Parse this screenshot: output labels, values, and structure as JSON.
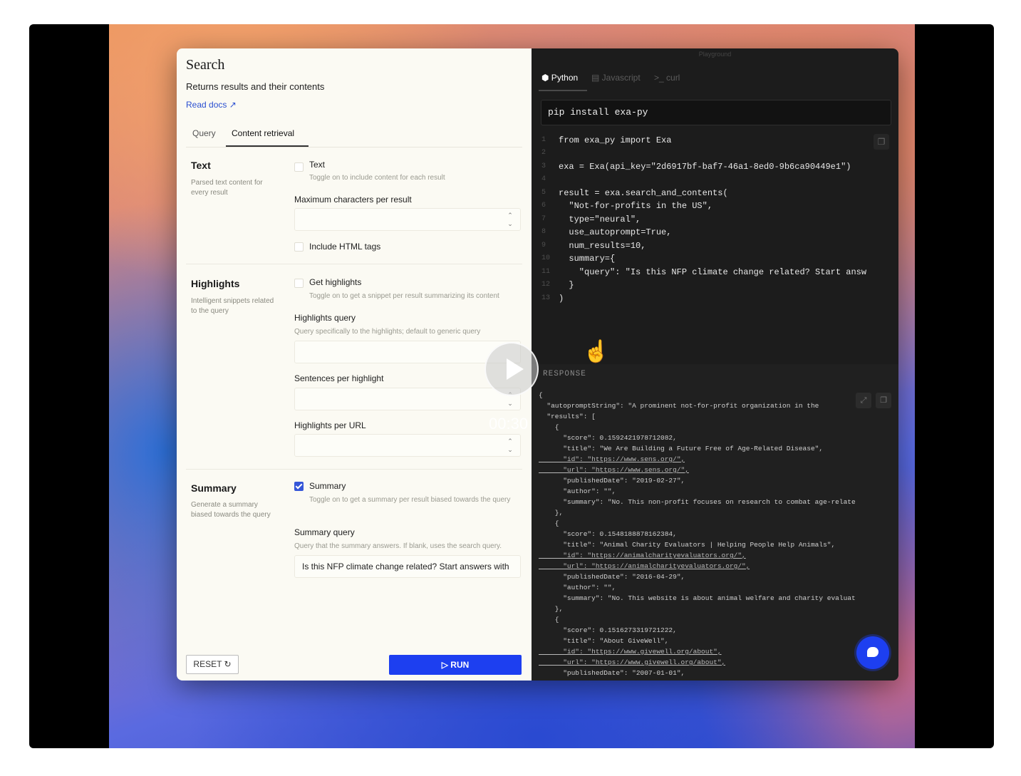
{
  "panel": {
    "title": "Search",
    "subtitle": "Returns results and their contents",
    "docs_link": "Read docs ↗",
    "tabs": [
      "Query",
      "Content retrieval"
    ],
    "active_tab": "Content retrieval"
  },
  "sections": {
    "text": {
      "heading": "Text",
      "description": "Parsed text content for every result",
      "option_label": "Text",
      "option_desc": "Toggle on to include content for each result",
      "option_checked": false,
      "max_chars_label": "Maximum characters per result",
      "max_chars_value": "",
      "html_tags_label": "Include HTML tags",
      "html_tags_checked": false
    },
    "highlights": {
      "heading": "Highlights",
      "description": "Intelligent snippets related to the query",
      "option_label": "Get highlights",
      "option_desc": "Toggle on to get a snippet per result summarizing its content",
      "option_checked": false,
      "query_label": "Highlights query",
      "query_hint": "Query specifically to the highlights; default to generic query",
      "query_value": "",
      "sentences_label": "Sentences per highlight",
      "sentences_value": "",
      "per_url_label": "Highlights per URL",
      "per_url_value": ""
    },
    "summary": {
      "heading": "Summary",
      "description": "Generate a summary biased towards the query",
      "option_label": "Summary",
      "option_desc": "Toggle on to get a summary per result biased towards the query",
      "option_checked": true,
      "query_label": "Summary query",
      "query_hint": "Query that the summary answers. If blank, uses the search query.",
      "query_value": "Is this NFP climate change related? Start answers with"
    }
  },
  "buttons": {
    "reset": "RESET ↻",
    "run": "▷ RUN"
  },
  "code_panel": {
    "window_title": "Playground",
    "lang_tabs": [
      {
        "label": "⬢ Python",
        "active": true
      },
      {
        "label": "▤ Javascript",
        "active": false
      },
      {
        "label": ">_ curl",
        "active": false
      }
    ],
    "install_cmd": "pip install exa-py",
    "lines": [
      {
        "n": "1",
        "t": "from exa_py import Exa"
      },
      {
        "n": "2",
        "t": ""
      },
      {
        "n": "3",
        "t": "exa = Exa(api_key=\"2d6917bf-baf7-46a1-8ed0-9b6ca90449e1\")"
      },
      {
        "n": "4",
        "t": ""
      },
      {
        "n": "5",
        "t": "result = exa.search_and_contents("
      },
      {
        "n": "6",
        "t": "  \"Not-for-profits in the US\","
      },
      {
        "n": "7",
        "t": "  type=\"neural\","
      },
      {
        "n": "8",
        "t": "  use_autoprompt=True,"
      },
      {
        "n": "9",
        "t": "  num_results=10,"
      },
      {
        "n": "10",
        "t": "  summary={"
      },
      {
        "n": "11",
        "t": "    \"query\": \"Is this NFP climate change related? Start answ"
      },
      {
        "n": "12",
        "t": "  }"
      },
      {
        "n": "13",
        "t": ")"
      }
    ]
  },
  "response": {
    "label": "RESPONSE",
    "lines": [
      "{",
      "  \"autopromptString\": \"A prominent not-for-profit organization in the",
      "  \"results\": [",
      "    {",
      "      \"score\": 0.1592421978712082,",
      "      \"title\": \"We Are Building a Future Free of Age-Related Disease\",",
      "      \"id\": \"https://www.sens.org/\",",
      "      \"url\": \"https://www.sens.org/\",",
      "      \"publishedDate\": \"2019-02-27\",",
      "      \"author\": \"\",",
      "      \"summary\": \"No. This non-profit focuses on research to combat age-relate",
      "    },",
      "    {",
      "      \"score\": 0.1548188878162384,",
      "      \"title\": \"Animal Charity Evaluators | Helping People Help Animals\",",
      "      \"id\": \"https://animalcharityevaluators.org/\",",
      "      \"url\": \"https://animalcharityevaluators.org/\",",
      "      \"publishedDate\": \"2016-04-29\",",
      "      \"author\": \"\",",
      "      \"summary\": \"No. This website is about animal welfare and charity evaluat",
      "    },",
      "    {",
      "      \"score\": 0.1516273319721222,",
      "      \"title\": \"About GiveWell\",",
      "      \"id\": \"https://www.givewell.org/about\",",
      "      \"url\": \"https://www.givewell.org/about\",",
      "      \"publishedDate\": \"2007-01-01\","
    ]
  },
  "video": {
    "timestamp": "00:30"
  }
}
